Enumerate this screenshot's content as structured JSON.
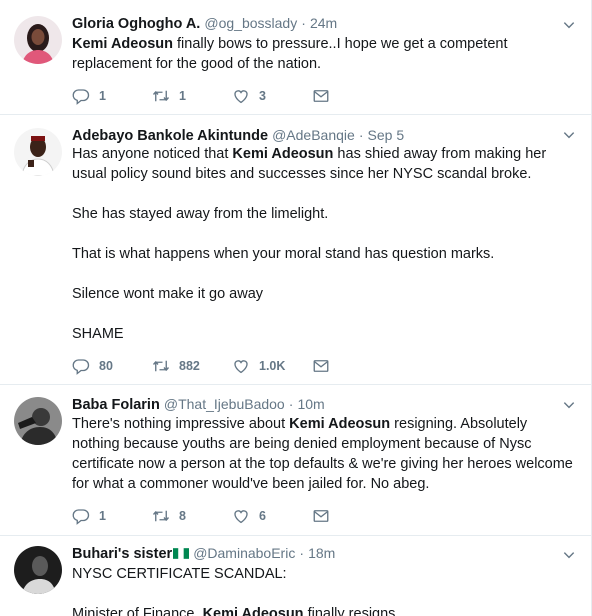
{
  "tweets": [
    {
      "name": "Gloria Oghogho A.",
      "handle": "@og_bosslady",
      "sep": "·",
      "time": "24m",
      "p1_kw": "Kemi Adeosun",
      "p1_rest": " finally bows to pressure..I hope we get a competent replacement for the good of the nation.",
      "replies": "1",
      "retweets": "1",
      "likes": "3"
    },
    {
      "name": "Adebayo Bankole Akintunde",
      "handle": "@AdeBanqie",
      "sep": "·",
      "time": "Sep 5",
      "p1_pre": "Has anyone noticed that ",
      "p1_kw": "Kemi Adeosun",
      "p1_rest": " has shied away from making her usual policy sound bites and successes since her NYSC scandal broke.",
      "p2": "She has stayed away from the limelight.",
      "p3": "That is what happens when your moral stand has question marks.",
      "p4": "Silence wont make it go away",
      "p5": "SHAME",
      "replies": "80",
      "retweets": "882",
      "likes": "1.0K"
    },
    {
      "name": "Baba Folarin",
      "handle": "@That_IjebuBadoo",
      "sep": "·",
      "time": "10m",
      "p1_pre": "There's nothing impressive about ",
      "p1_kw": "Kemi Adeosun",
      "p1_rest": " resigning. Absolutely nothing because youths are being denied employment because of Nysc certificate now a person at the top defaults & we're giving her heroes welcome for what a commoner would've been jailed for. No abeg.",
      "replies": "1",
      "retweets": "8",
      "likes": "6"
    },
    {
      "name": "Buhari's sister",
      "handle": "@DaminaboEric",
      "sep": "·",
      "time": "18m",
      "p1": "NYSC CERTIFICATE SCANDAL:",
      "p2_pre": "Minister of Finance, ",
      "p2_kw": "Kemi Adeosun",
      "p2_rest": " finally resigns."
    }
  ],
  "colors": {
    "text": "#14171a",
    "muted": "#657786",
    "border": "#e6ecf0",
    "flag_green": "#008751"
  },
  "icons": [
    "reply-icon",
    "retweet-icon",
    "like-icon",
    "direct-message-icon",
    "chevron-down-icon",
    "nigeria-flag-icon"
  ]
}
